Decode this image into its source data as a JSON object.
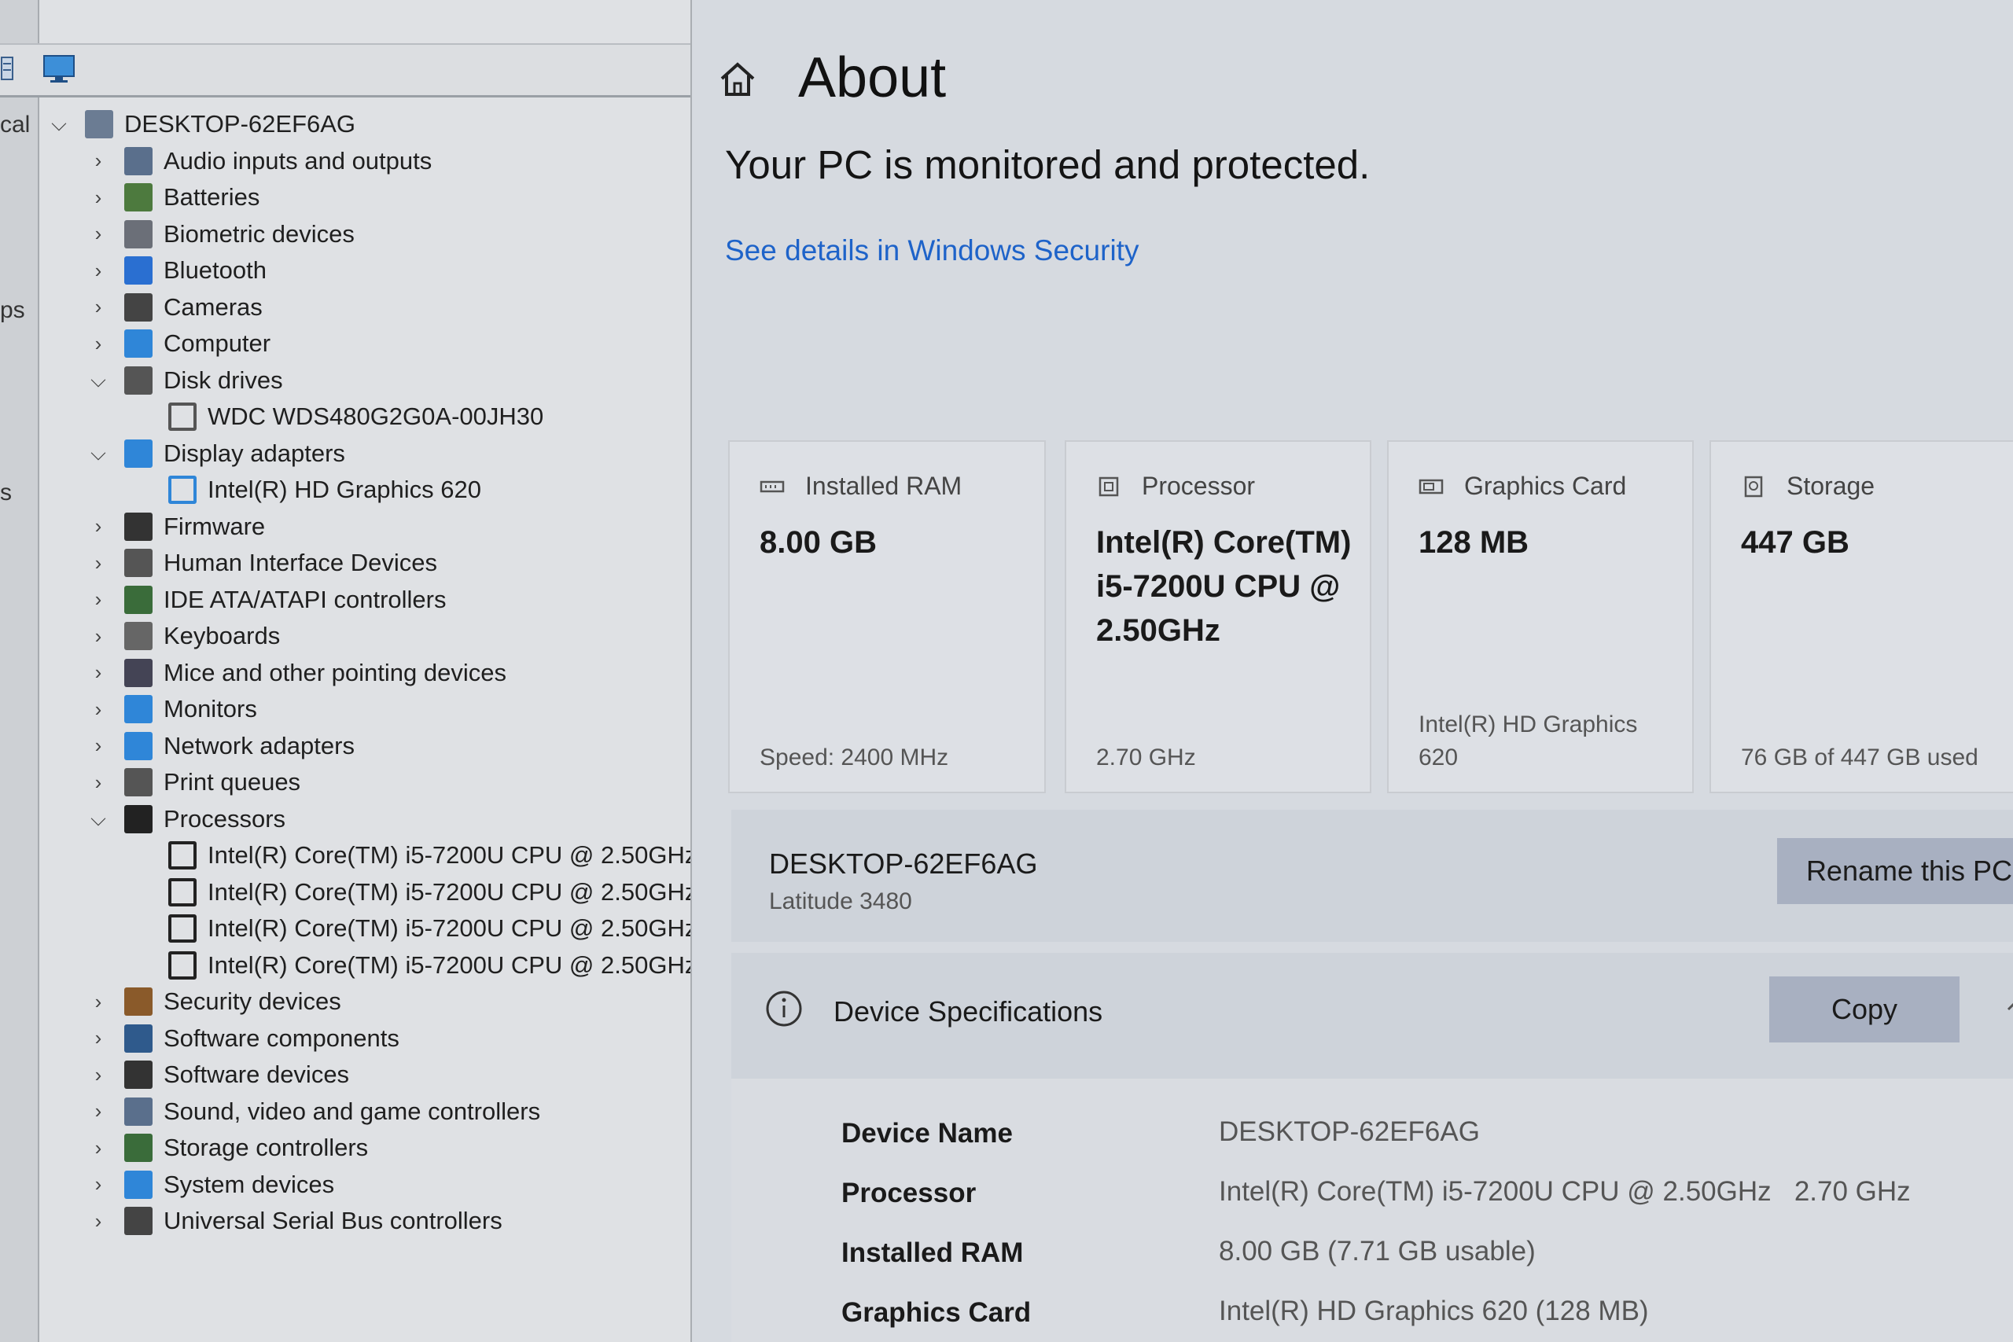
{
  "device_manager": {
    "edge_fragments": [
      "cal",
      "ps",
      "s"
    ],
    "root": "DESKTOP-62EF6AG",
    "tree": [
      {
        "label": "Audio inputs and outputs",
        "expanded": false,
        "icon": "speaker-icon",
        "color": "#5a6f8c"
      },
      {
        "label": "Batteries",
        "expanded": false,
        "icon": "battery-icon",
        "color": "#4d7a3e"
      },
      {
        "label": "Biometric devices",
        "expanded": false,
        "icon": "fingerprint-icon",
        "color": "#6b6f78"
      },
      {
        "label": "Bluetooth",
        "expanded": false,
        "icon": "bluetooth-icon",
        "color": "#2a6fd1"
      },
      {
        "label": "Cameras",
        "expanded": false,
        "icon": "camera-icon",
        "color": "#444"
      },
      {
        "label": "Computer",
        "expanded": false,
        "icon": "monitor-icon",
        "color": "#2f86d8"
      },
      {
        "label": "Disk drives",
        "expanded": true,
        "icon": "disk-icon",
        "color": "#555",
        "children": [
          {
            "label": "WDC WDS480G2G0A-00JH30",
            "icon": "disk-icon",
            "color": "#555"
          }
        ]
      },
      {
        "label": "Display adapters",
        "expanded": true,
        "icon": "display-adapter-icon",
        "color": "#2f86d8",
        "children": [
          {
            "label": "Intel(R) HD Graphics 620",
            "icon": "display-adapter-icon",
            "color": "#2f86d8"
          }
        ]
      },
      {
        "label": "Firmware",
        "expanded": false,
        "icon": "chip-icon",
        "color": "#333"
      },
      {
        "label": "Human Interface Devices",
        "expanded": false,
        "icon": "hid-icon",
        "color": "#555"
      },
      {
        "label": "IDE ATA/ATAPI controllers",
        "expanded": false,
        "icon": "controller-icon",
        "color": "#3a6c3a"
      },
      {
        "label": "Keyboards",
        "expanded": false,
        "icon": "keyboard-icon",
        "color": "#666"
      },
      {
        "label": "Mice and other pointing devices",
        "expanded": false,
        "icon": "mouse-icon",
        "color": "#445"
      },
      {
        "label": "Monitors",
        "expanded": false,
        "icon": "monitor-icon",
        "color": "#2f86d8"
      },
      {
        "label": "Network adapters",
        "expanded": false,
        "icon": "network-icon",
        "color": "#2f86d8"
      },
      {
        "label": "Print queues",
        "expanded": false,
        "icon": "printer-icon",
        "color": "#555"
      },
      {
        "label": "Processors",
        "expanded": true,
        "icon": "processor-icon",
        "color": "#222",
        "children": [
          {
            "label": "Intel(R) Core(TM) i5-7200U CPU @ 2.50GHz",
            "icon": "processor-icon",
            "color": "#222"
          },
          {
            "label": "Intel(R) Core(TM) i5-7200U CPU @ 2.50GHz",
            "icon": "processor-icon",
            "color": "#222"
          },
          {
            "label": "Intel(R) Core(TM) i5-7200U CPU @ 2.50GHz",
            "icon": "processor-icon",
            "color": "#222"
          },
          {
            "label": "Intel(R) Core(TM) i5-7200U CPU @ 2.50GHz",
            "icon": "processor-icon",
            "color": "#222"
          }
        ]
      },
      {
        "label": "Security devices",
        "expanded": false,
        "icon": "key-icon",
        "color": "#8a5a2a"
      },
      {
        "label": "Software components",
        "expanded": false,
        "icon": "component-icon",
        "color": "#2f5a8c"
      },
      {
        "label": "Software devices",
        "expanded": false,
        "icon": "software-device-icon",
        "color": "#333"
      },
      {
        "label": "Sound, video and game controllers",
        "expanded": false,
        "icon": "speaker-icon",
        "color": "#5a6f8c"
      },
      {
        "label": "Storage controllers",
        "expanded": false,
        "icon": "storage-controller-icon",
        "color": "#3a6c3a"
      },
      {
        "label": "System devices",
        "expanded": false,
        "icon": "system-icon",
        "color": "#2f86d8"
      },
      {
        "label": "Universal Serial Bus controllers",
        "expanded": false,
        "icon": "usb-icon",
        "color": "#444"
      }
    ]
  },
  "about": {
    "title": "About",
    "protection_status": "Your PC is monitored and protected.",
    "security_link": "See details in Windows Security",
    "cards": [
      {
        "title": "Installed RAM",
        "value": "8.00 GB",
        "sub": "Speed: 2400 MHz",
        "icon": "ram-icon"
      },
      {
        "title": "Processor",
        "value": "Intel(R) Core(TM) i5-7200U CPU @ 2.50GHz",
        "value_lines": [
          "Intel(R) Core(TM)",
          "i5-7200U CPU @",
          "2.50GHz"
        ],
        "sub": "2.70 GHz",
        "icon": "processor-icon"
      },
      {
        "title": "Graphics Card",
        "value": "128 MB",
        "sub_lines": [
          "Intel(R) HD Graphics",
          "620"
        ],
        "icon": "graphics-card-icon"
      },
      {
        "title": "Storage",
        "value": "447 GB",
        "sub": "76 GB of 447 GB used",
        "icon": "storage-icon"
      }
    ],
    "pc_name": "DESKTOP-62EF6AG",
    "model": "Latitude 3480",
    "rename_button": "Rename this PC",
    "specs_title": "Device Specifications",
    "copy_button": "Copy",
    "specs": [
      {
        "key": "Device Name",
        "value": "DESKTOP-62EF6AG"
      },
      {
        "key": "Processor",
        "value": "Intel(R) Core(TM) i5-7200U CPU @ 2.50GHz   2.70 GHz"
      },
      {
        "key": "Installed RAM",
        "value": "8.00 GB (7.71 GB usable)"
      },
      {
        "key": "Graphics Card",
        "value": "Intel(R) HD Graphics 620 (128 MB)"
      }
    ],
    "link_color": "#1e63c9",
    "button_color": "#a8b0c1"
  }
}
